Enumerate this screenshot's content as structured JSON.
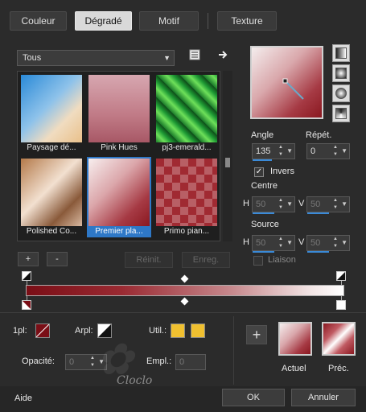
{
  "tabs": [
    {
      "label": "Couleur"
    },
    {
      "label": "Dégradé"
    },
    {
      "label": "Motif"
    },
    {
      "label": "Texture"
    }
  ],
  "dropdown": {
    "value": "Tous"
  },
  "gradients": [
    {
      "caption": "Paysage dé...",
      "selected": false
    },
    {
      "caption": "Pink Hues",
      "selected": false
    },
    {
      "caption": "pj3-emerald...",
      "selected": false
    },
    {
      "caption": "Polished Co...",
      "selected": false
    },
    {
      "caption": "Premier pla...",
      "selected": true
    },
    {
      "caption": "Primo pian...",
      "selected": false
    }
  ],
  "list_buttons": {
    "add": "+",
    "remove": "-",
    "reset": "Réinit.",
    "save": "Enreg."
  },
  "angle": {
    "label": "Angle",
    "value": "135"
  },
  "repeat": {
    "label": "Répét.",
    "value": "0"
  },
  "invert": {
    "label": "Invers",
    "checked": true
  },
  "centre": {
    "label": "Centre",
    "h_label": "H",
    "h_value": "50",
    "v_label": "V",
    "v_value": "50"
  },
  "source": {
    "label": "Source",
    "h_label": "H",
    "h_value": "50",
    "v_label": "V",
    "v_value": "50"
  },
  "link": {
    "label": "Liaison"
  },
  "stops": {
    "opl_label": "1pl:",
    "arpl_label": "Arpl:",
    "util_label": "Util.:",
    "opacity_label": "Opacité:",
    "opacity_value": "0",
    "empl_label": "Empl.:",
    "empl_value": "0"
  },
  "swatches": {
    "current_label": "Actuel",
    "previous_label": "Préc."
  },
  "footer": {
    "help": "Aide",
    "ok": "OK",
    "cancel": "Annuler"
  },
  "watermark": {
    "text": "Cloclo"
  },
  "colors": {
    "accent": "#3a8ad8",
    "dark_red": "#7a0e16",
    "yellow": "#f0c030"
  }
}
